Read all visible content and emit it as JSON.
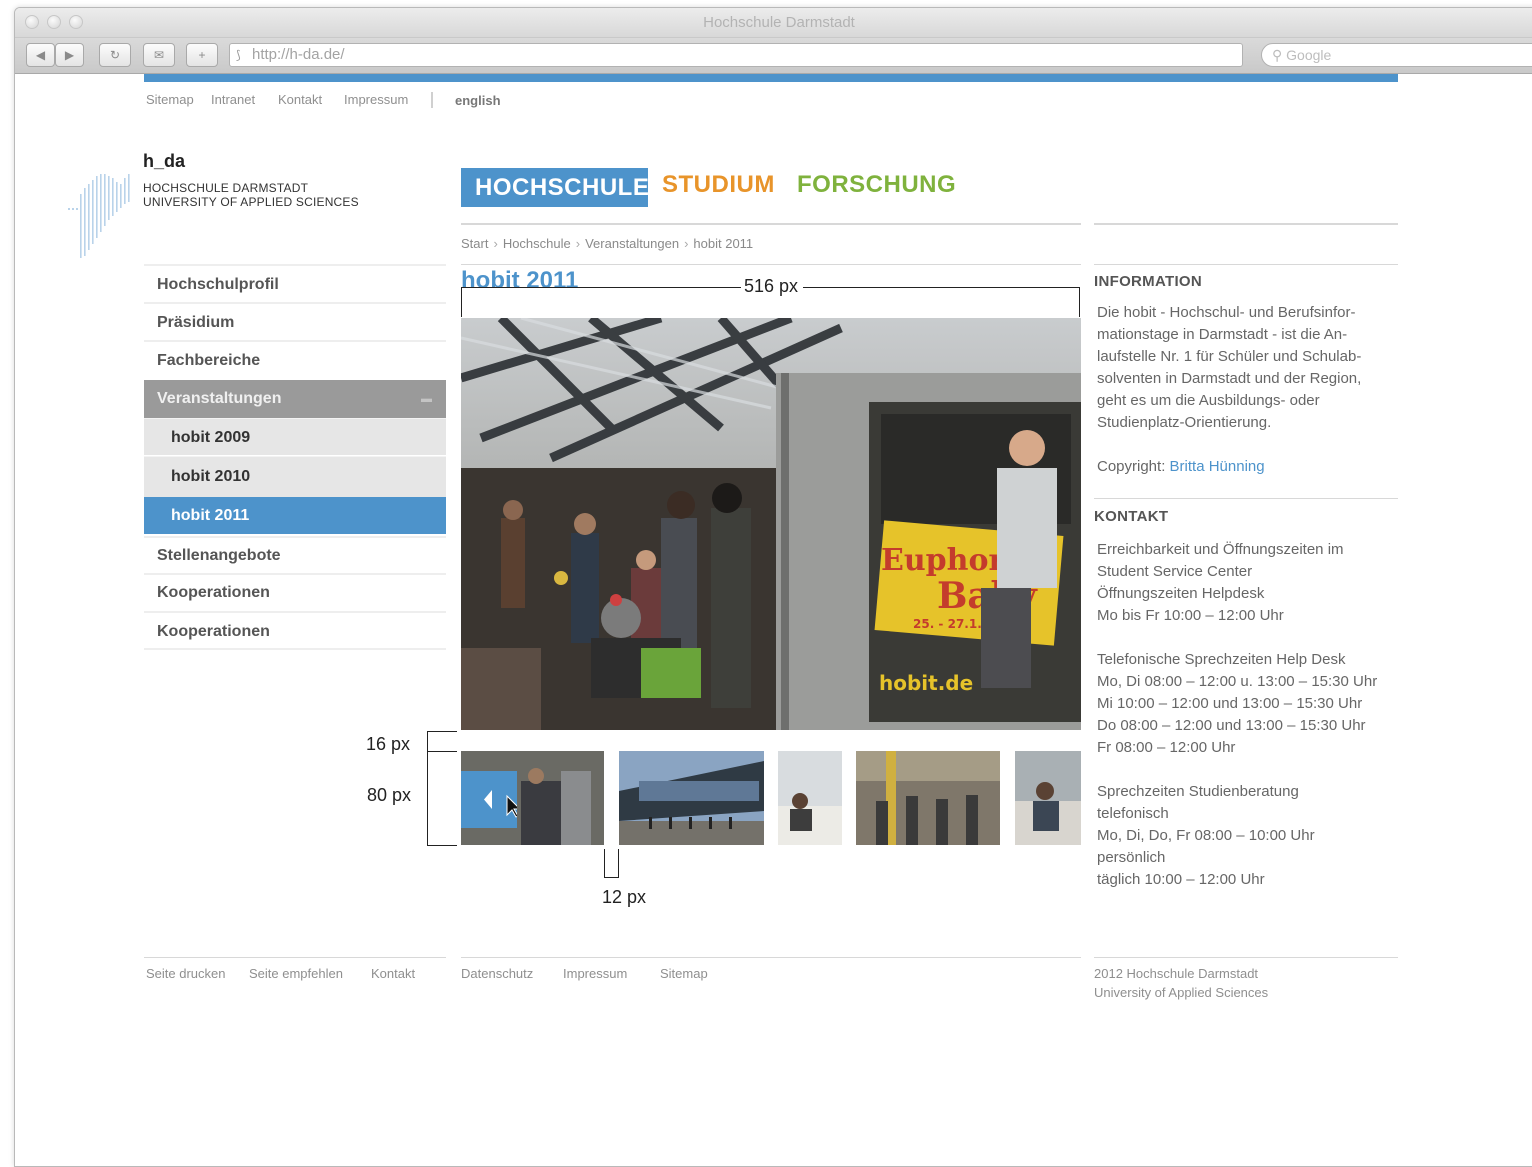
{
  "browser": {
    "window_title": "Hochschule Darmstadt",
    "url": "http://h-da.de/",
    "search_placeholder": "Google",
    "icons": [
      "back-icon",
      "forward-icon",
      "reload-icon",
      "add-bookmark-icon",
      "plus-icon",
      "search-icon"
    ]
  },
  "meta_nav": {
    "links": [
      "Sitemap",
      "Intranet",
      "Kontakt",
      "Impressum"
    ],
    "language": "english"
  },
  "logo": {
    "title": "h_da",
    "line1": "HOCHSCHULE DARMSTADT",
    "line2": "UNIVERSITY OF APPLIED SCIENCES"
  },
  "main_nav": {
    "tabs": [
      "HOCHSCHULE",
      "STUDIUM",
      "FORSCHUNG"
    ],
    "active": "HOCHSCHULE",
    "colors": {
      "hochschule": "#4d93cb",
      "studium": "#e8942a",
      "forschung": "#7fb23d"
    }
  },
  "breadcrumb": [
    "Start",
    "Hochschule",
    "Veranstaltungen",
    "hobit 2011"
  ],
  "sidebar": {
    "items": [
      "Hochschulprofil",
      "Präsidium",
      "Fachbereiche",
      "Veranstaltungen",
      "hobit 2009",
      "hobit 2010",
      "hobit 2011",
      "Stellenangebote",
      "Kooperationen",
      "Kooperationen"
    ],
    "expanded": "Veranstaltungen",
    "selected": "hobit 2011"
  },
  "content": {
    "title": "hobit 2011",
    "poster_line1": "Euphorie,",
    "poster_line2": "Baby",
    "poster_date": "25. - 27.1.2011",
    "poster_footer": "hobit.de",
    "thumbnail_count": 5
  },
  "info": {
    "heading": "INFORMATION",
    "lines": [
      "Die hobit - Hochschul- und Berufsinfor-",
      "mationstage in Darmstadt - ist die An-",
      "laufstelle Nr. 1 für Schüler und Schulab-",
      "solventen in Darmstadt und der Region,",
      "geht es um die Ausbildungs- oder",
      "Studienplatz-Orientierung."
    ],
    "copyright_label": "Copyright:",
    "copyright_name": "Britta Hünning"
  },
  "kontakt": {
    "heading": "KONTAKT",
    "lines": [
      "Erreichbarkeit und Öffnungszeiten im",
      "Student Service Center",
      "Öffnungszeiten Helpdesk",
      "Mo bis Fr 10:00 – 12:00 Uhr",
      "Telefonische Sprechzeiten Help Desk",
      "Mo, Di 08:00 – 12:00 u. 13:00 – 15:30 Uhr",
      "Mi 10:00 – 12:00 und 13:00 – 15:30 Uhr",
      "Do 08:00 – 12:00 und 13:00 – 15:30 Uhr",
      "Fr 08:00 – 12:00 Uhr",
      "Sprechzeiten Studienberatung",
      "telefonisch",
      "Mo, Di, Do, Fr 08:00 – 10:00 Uhr",
      "persönlich",
      "täglich 10:00 – 12:00 Uhr"
    ]
  },
  "annotations": {
    "width": "516 px",
    "gap": "16 px",
    "thumb_height": "80 px",
    "thumb_gap": "12 px"
  },
  "footer": {
    "left_links": [
      "Seite drucken",
      "Seite empfehlen",
      "Kontakt"
    ],
    "mid_links": [
      "Datenschutz",
      "Impressum",
      "Sitemap"
    ],
    "copyright1": "2012 Hochschule Darmstadt",
    "copyright2": "University of Applied Sciences"
  }
}
